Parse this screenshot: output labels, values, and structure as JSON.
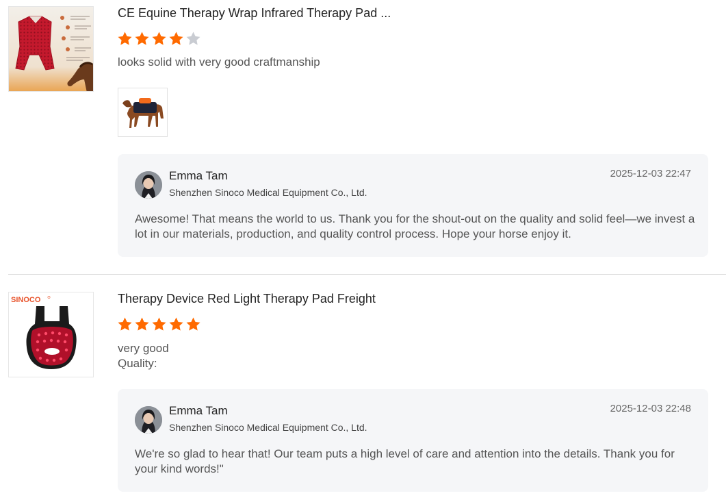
{
  "reviews": [
    {
      "product_title": "CE Equine Therapy Wrap Infrared Therapy Pad ...",
      "rating": 4,
      "rating_max": 5,
      "comment_lines": [
        "looks solid with very good craftmanship"
      ],
      "has_photo": true,
      "reply": {
        "name": "Emma Tam",
        "company": "Shenzhen Sinoco Medical Equipment Co., Ltd.",
        "date": "2025-12-03 22:47",
        "text": "Awesome! That means the world to us. Thank you for the shout-out on the quality and solid feel—we invest a lot in our materials, production, and quality control process. Hope your horse enjoy it."
      }
    },
    {
      "product_title": "Therapy Device Red Light Therapy Pad Freight",
      "brand_label": "SINOCO",
      "rating": 5,
      "rating_max": 5,
      "comment_lines": [
        "very good",
        "Quality:"
      ],
      "has_photo": false,
      "reply": {
        "name": "Emma Tam",
        "company": "Shenzhen Sinoco Medical Equipment Co., Ltd.",
        "date": "2025-12-03 22:48",
        "text": "We're so glad to hear that! Our team puts a high level of care and attention into the details. Thank you for your kind words!\""
      }
    }
  ],
  "colors": {
    "star_on": "#ff6a00",
    "star_off": "#c9ccd2",
    "reply_bg": "#f5f6f8",
    "brand": "#e8532b"
  }
}
